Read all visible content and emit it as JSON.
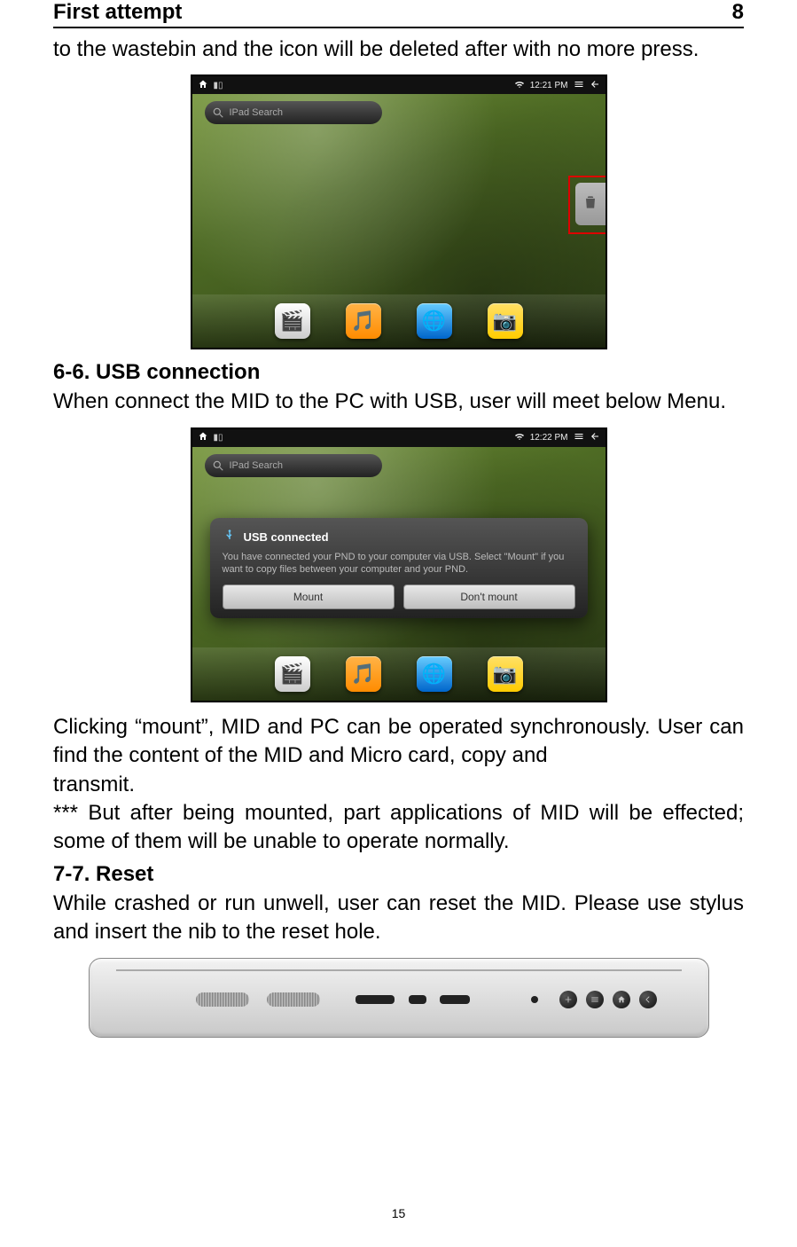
{
  "header": {
    "title": "First attempt",
    "page_label": "8"
  },
  "intro_para": "to the wastebin and the icon will be deleted after with no more press.",
  "fig1": {
    "statusbar_time": "12:21 PM",
    "search_placeholder": "IPad Search"
  },
  "section_6_6": {
    "heading": "6-6. USB connection",
    "para": "When connect the MID to the PC with USB, user will meet below Menu."
  },
  "fig2": {
    "statusbar_time": "12:22 PM",
    "search_placeholder": "IPad Search",
    "dialog": {
      "title": "USB connected",
      "message": "You have connected your PND to your computer via USB. Select \"Mount\" if you want to copy files between your computer and your PND.",
      "mount_label": "Mount",
      "dont_mount_label": "Don't mount"
    }
  },
  "after_fig2_para1": "Clicking “mount”, MID and PC can be operated synchronously. User can find the content of the MID and Micro card, copy and",
  "after_fig2_para1b": "transmit.",
  "after_fig2_para2": "*** But after being mounted, part applications of MID will be effected; some of them will be unable to operate normally.",
  "section_7_7": {
    "heading": "7-7. Reset",
    "para": "While crashed or run unwell, user can reset the MID. Please use stylus and insert the nib to the reset hole."
  },
  "footer_page_number": "15"
}
